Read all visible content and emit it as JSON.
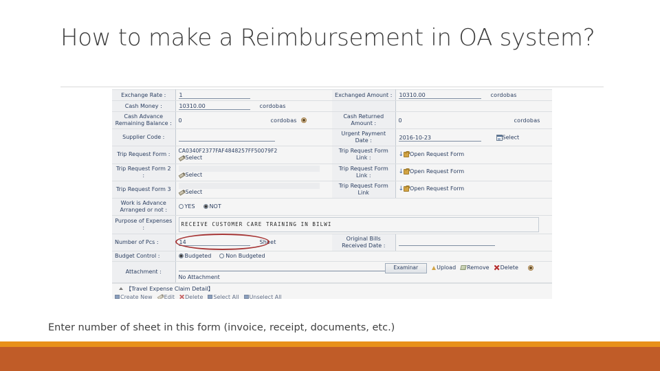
{
  "slide": {
    "title": "How to make a Reimbursement in OA system?",
    "caption": "Enter number of sheet in this form  (invoice, receipt, documents, etc.)",
    "accent_orange": "#E8901A",
    "accent_rust": "#C05C28",
    "highlight_color": "#A02525"
  },
  "form": {
    "rows": {
      "exchange_rate": {
        "label": "Exchange Rate :",
        "value": "1"
      },
      "exchanged_amount": {
        "label": "Exchanged Amount :",
        "value": "10310.00",
        "unit": "cordobas"
      },
      "cash_money": {
        "label": "Cash Money :",
        "value": "10310.00",
        "unit": "cordobas"
      },
      "cash_advance_remaining": {
        "label": "Cash Advance Remaining Balance :",
        "value": "0",
        "unit": "cordobas"
      },
      "cash_returned": {
        "label": "Cash Returned Amount :",
        "value": "0",
        "unit": "cordobas"
      },
      "supplier_code": {
        "label": "Supplier Code :",
        "value": ""
      },
      "urgent_payment_date": {
        "label": "Urgent Payment Date :",
        "value": "2016-10-23",
        "select_label": "Select"
      },
      "trip_request_form": {
        "label": "Trip Request Form :",
        "value": "CA0340F2377FAF4848257FF50079F2",
        "select_label": "Select"
      },
      "trip_request_form_link": {
        "label": "Trip Request Form Link :",
        "link_label": "Open Request Form"
      },
      "trip_request_form_2": {
        "label": "Trip Request Form 2 :",
        "value": "",
        "select_label": "Select"
      },
      "trip_request_form_link_2": {
        "label": "Trip Request Form Link :",
        "link_label": "Open Request Form"
      },
      "trip_request_form_3": {
        "label": "Trip Request Form 3",
        "value": "",
        "select_label": "Select"
      },
      "trip_request_form_link_3": {
        "label": "Trip Request Form Link",
        "link_label": "Open Request Form"
      },
      "work_in_advance": {
        "label": "Work is Advance Arranged or not :",
        "option_yes": "YES",
        "option_not": "NOT",
        "selected": "NOT"
      },
      "purpose_of_expenses": {
        "label": "Purpose of Expenses :",
        "value": "RECEIVE CUSTOMER CARE TRAINING IN BILWI"
      },
      "number_of_pcs": {
        "label": "Number of Pcs :",
        "value": "14",
        "unit": "Sheet"
      },
      "original_bills_date": {
        "label": "Original Bills Received Date :",
        "value": ""
      },
      "budget_control": {
        "label": "Budget Control :",
        "option_budgeted": "Budgeted",
        "option_non_budgeted": "Non Budgeted",
        "selected": "Budgeted"
      },
      "attachment": {
        "label": "Attachment :",
        "browse_label": "Examinar",
        "upload_label": "Upload",
        "remove_label": "Remove",
        "delete_label": "Delete",
        "status": "No Attachment"
      }
    },
    "detail_section": {
      "title": "【Travel Expense Claim Detail】"
    },
    "detail_toolbar": {
      "create_new": "Create New",
      "edit": "Edit",
      "delete": "Delete",
      "select_all": "Select All",
      "unselect_all": "Unselect All"
    }
  }
}
